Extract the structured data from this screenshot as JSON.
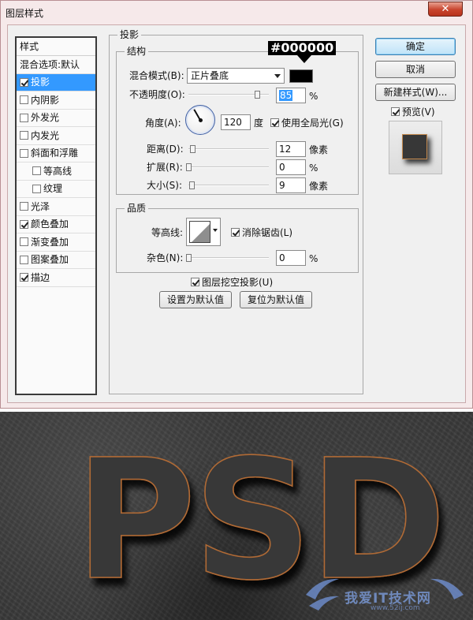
{
  "window": {
    "title": "图层样式",
    "close_glyph": "✕"
  },
  "styles_list": {
    "header": "样式",
    "items": [
      {
        "label": "混合选项:默认",
        "checkbox": false,
        "checked": false,
        "indent": false,
        "selected": false
      },
      {
        "label": "投影",
        "checkbox": true,
        "checked": true,
        "indent": false,
        "selected": true
      },
      {
        "label": "内阴影",
        "checkbox": true,
        "checked": false,
        "indent": false,
        "selected": false
      },
      {
        "label": "外发光",
        "checkbox": true,
        "checked": false,
        "indent": false,
        "selected": false
      },
      {
        "label": "内发光",
        "checkbox": true,
        "checked": false,
        "indent": false,
        "selected": false
      },
      {
        "label": "斜面和浮雕",
        "checkbox": true,
        "checked": false,
        "indent": false,
        "selected": false
      },
      {
        "label": "等高线",
        "checkbox": true,
        "checked": false,
        "indent": true,
        "selected": false
      },
      {
        "label": "纹理",
        "checkbox": true,
        "checked": false,
        "indent": true,
        "selected": false
      },
      {
        "label": "光泽",
        "checkbox": true,
        "checked": false,
        "indent": false,
        "selected": false
      },
      {
        "label": "颜色叠加",
        "checkbox": true,
        "checked": true,
        "indent": false,
        "selected": false
      },
      {
        "label": "渐变叠加",
        "checkbox": true,
        "checked": false,
        "indent": false,
        "selected": false
      },
      {
        "label": "图案叠加",
        "checkbox": true,
        "checked": false,
        "indent": false,
        "selected": false
      },
      {
        "label": "描边",
        "checkbox": true,
        "checked": true,
        "indent": false,
        "selected": false
      }
    ]
  },
  "drop_shadow": {
    "group_title": "投影",
    "structure": {
      "title": "结构",
      "blend_mode_label": "混合模式(B):",
      "blend_mode_value": "正片叠底",
      "shadow_color": "#000000",
      "color_annotation": "#000000",
      "opacity_label": "不透明度(O):",
      "opacity_value": "85",
      "opacity_unit": "%",
      "opacity_level": 0.85,
      "angle_label": "角度(A):",
      "angle_value": "120",
      "angle_unit": "度",
      "global_light_label": "使用全局光(G)",
      "global_light_checked": true,
      "distance_label": "距离(D):",
      "distance_value": "12",
      "distance_unit": "像素",
      "distance_level": 0.05,
      "spread_label": "扩展(R):",
      "spread_value": "0",
      "spread_unit": "%",
      "spread_level": 0.0,
      "size_label": "大小(S):",
      "size_value": "9",
      "size_unit": "像素",
      "size_level": 0.04
    },
    "quality": {
      "title": "品质",
      "contour_label": "等高线:",
      "antialias_label": "消除锯齿(L)",
      "antialias_checked": true,
      "noise_label": "杂色(N):",
      "noise_value": "0",
      "noise_unit": "%",
      "noise_level": 0.0
    },
    "knockout_label": "图层挖空投影(U)",
    "knockout_checked": true,
    "make_default_label": "设置为默认值",
    "reset_default_label": "复位为默认值"
  },
  "buttons": {
    "ok": "确定",
    "cancel": "取消",
    "new_style": "新建样式(W)...",
    "preview_label": "预览(V)",
    "preview_checked": true
  },
  "result": {
    "text": "PSD",
    "watermark": "我爱IT技术网",
    "watermark_url": "www.52ij.com"
  }
}
